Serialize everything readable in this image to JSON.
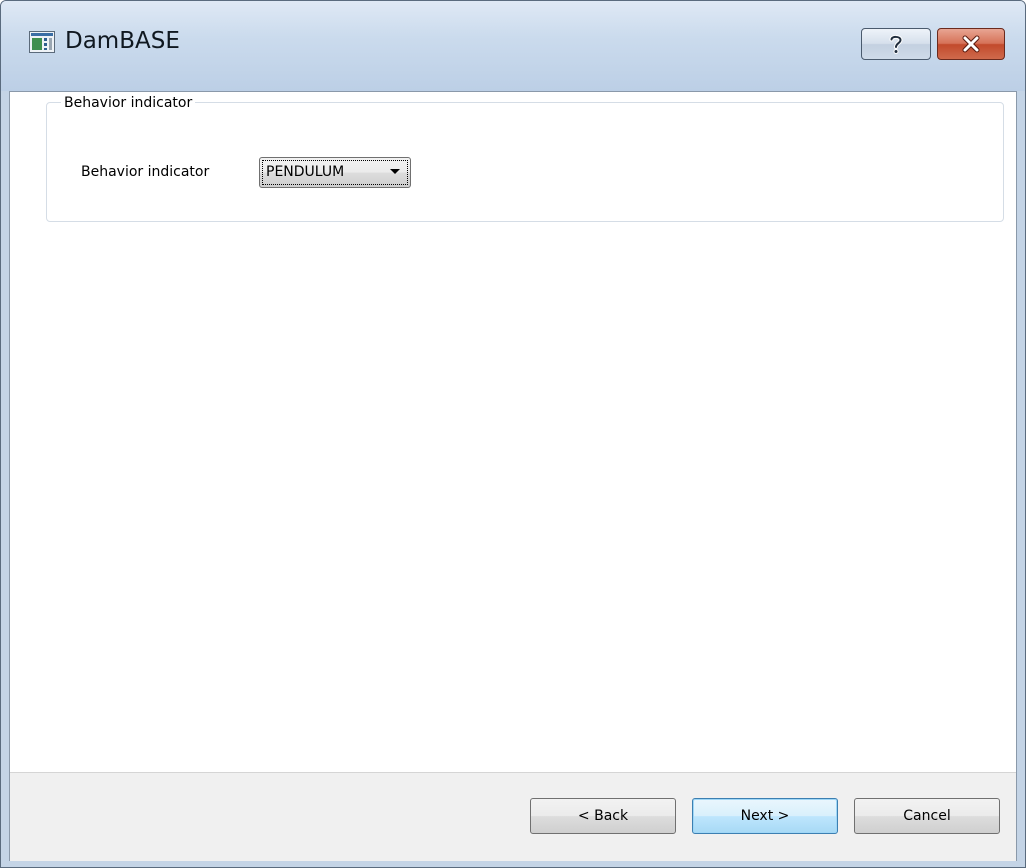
{
  "window": {
    "title": "DamBASE",
    "icon": "app-window-icon"
  },
  "caption_buttons": {
    "help_label": "?",
    "help_icon": "help-icon",
    "close_icon": "close-icon"
  },
  "group": {
    "title": "Behavior indicator",
    "field_label": "Behavior indicator",
    "combo_value": "PENDULUM",
    "combo_icon": "chevron-down-icon"
  },
  "footer": {
    "back_label": "< Back",
    "next_label": "Next >",
    "cancel_label": "Cancel"
  },
  "colors": {
    "titlebar": "#c4d4e6",
    "close_button": "#c24a2c",
    "default_button_border": "#3c7fb1",
    "footer_bg": "#f0f0f0"
  }
}
